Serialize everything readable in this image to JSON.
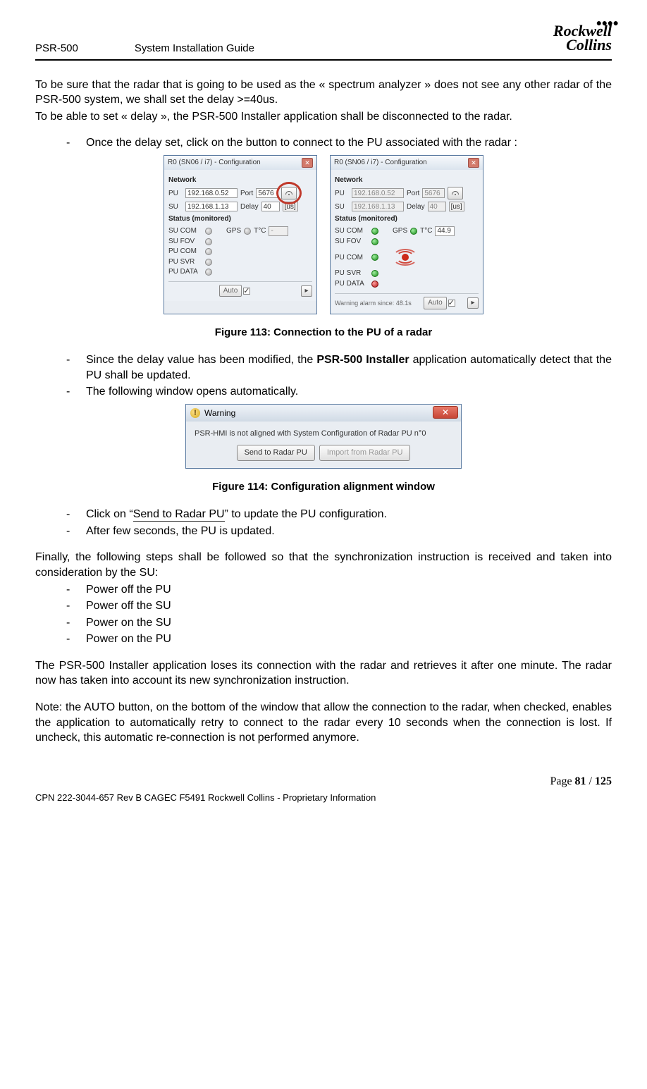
{
  "header": {
    "doc_id": "PSR-500",
    "doc_title": "System Installation Guide",
    "logo_line1": "Rockwell",
    "logo_line2": "Collins"
  },
  "body": {
    "para1a": "To be sure that the radar that is going to be used as the « spectrum analyzer » does not see any other radar of the PSR-500 system, we shall set the delay >=40us.",
    "para1b": "To be able to set « delay », the PSR-500 Installer application shall be disconnected to the radar.",
    "bullet1": "Once the delay set, click on the button to connect to the PU associated with the radar :",
    "fig113": "Figure 113: Connection to the PU of a radar",
    "bullet2_pre": "Since the delay value has been modified, the ",
    "bullet2_bold": "PSR-500 Installer",
    "bullet2_post": " application automatically detect that the PU shall be updated.",
    "bullet3": "The following window opens automatically.",
    "fig114": "Figure 114: Configuration alignment window",
    "bullet4_pre": "Click on “",
    "bullet4_link": "Send to Radar PU",
    "bullet4_post": "” to update the PU configuration.",
    "bullet5": "After few seconds, the PU is updated.",
    "para3": "Finally, the following steps shall be followed so that the synchronization instruction is received and taken into consideration by the SU:",
    "steps": [
      "Power off the PU",
      "Power off the SU",
      "Power on the SU",
      "Power on the PU"
    ],
    "para4": "The PSR-500 Installer application loses its connection with the radar and retrieves it after one minute. The radar now has taken into account its new synchronization instruction.",
    "para5": "Note: the AUTO button, on the bottom of the window that allow the connection to the radar, when checked, enables the application to automatically retry to connect to the radar every 10 seconds when the connection is lost. If uncheck, this automatic re-connection is not performed anymore."
  },
  "win": {
    "title": "R0 (SN06 / i7) - Configuration",
    "network": "Network",
    "pu": "PU",
    "su": "SU",
    "port": "Port",
    "delay": "Delay",
    "unit": "[us]",
    "ip_pu": "192.168.0.52",
    "port_val": "5676",
    "ip_su": "192.168.1.13",
    "delay_val": "40",
    "status_hdr": "Status (monitored)",
    "sucom": "SU COM",
    "sufov": "SU FOV",
    "pucom": "PU COM",
    "pusvr": "PU SVR",
    "pudata": "PU DATA",
    "gps": "GPS",
    "tc": "T°C",
    "temp_blank": "-",
    "temp_val": "44.9",
    "auto": "Auto",
    "warning_since": "Warning alarm since: 48.1s"
  },
  "warn": {
    "title": "Warning",
    "msg": "PSR-HMI is not aligned with System Configuration of Radar PU n°0",
    "btn_send": "Send to Radar PU",
    "btn_import": "Import from Radar PU"
  },
  "footer": {
    "page_pre": "Page ",
    "page_cur": "81",
    "page_sep": " / ",
    "page_total": "125",
    "proprietary": "CPN 222-3044-657 Rev B CAGEC F5491 Rockwell Collins - Proprietary Information"
  }
}
